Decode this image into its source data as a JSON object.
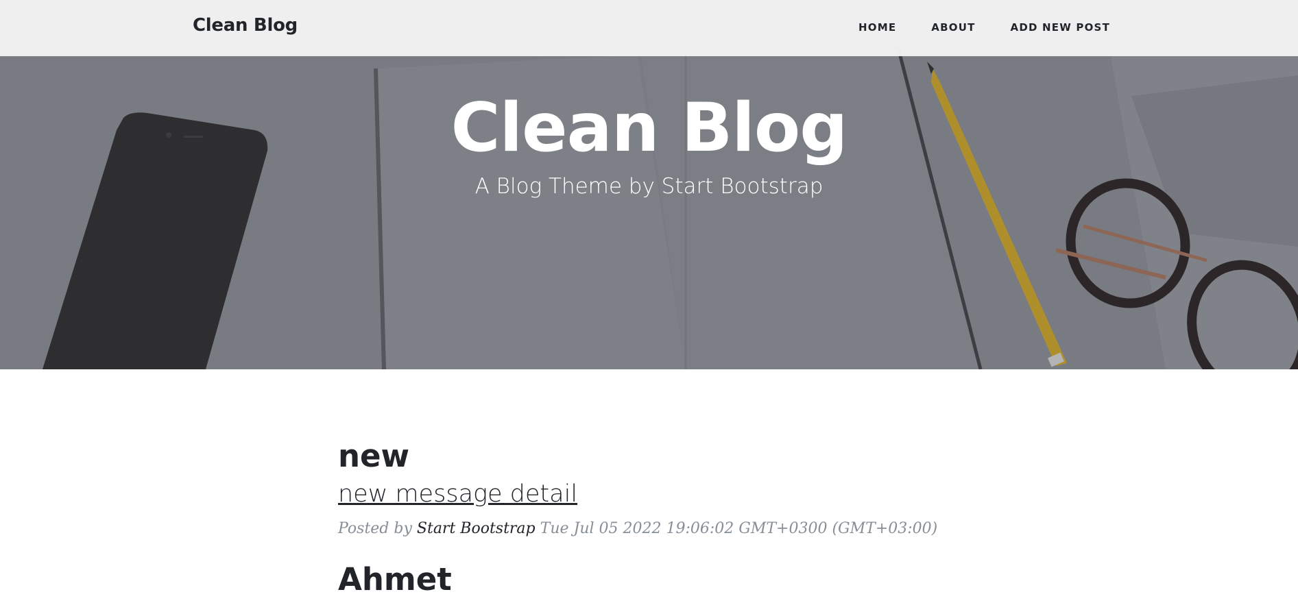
{
  "navbar": {
    "brand": "Clean Blog",
    "links": [
      "HOME",
      "ABOUT",
      "ADD NEW POST"
    ]
  },
  "hero": {
    "title": "Clean Blog",
    "subtitle": "A Blog Theme by Start Bootstrap"
  },
  "posts": [
    {
      "title": "new",
      "subtitle": "new message detail",
      "meta_prefix": "Posted by",
      "author": "Start Bootstrap",
      "date": "Tue Jul 05 2022 19:06:02 GMT+0300 (GMT+03:00)"
    },
    {
      "title": "Ahmet"
    }
  ],
  "colors": {
    "text": "#212529",
    "meta": "#868e96",
    "hero_tint": "#80838a",
    "navbar_bg": "#f4f4f4"
  }
}
